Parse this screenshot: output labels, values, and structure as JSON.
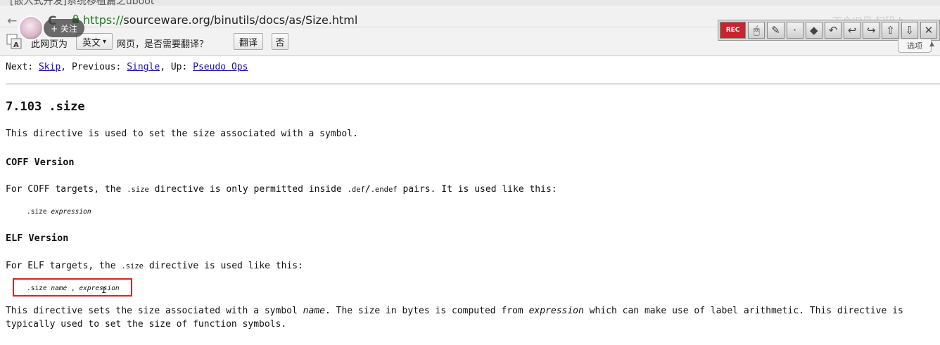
{
  "browser": {
    "tab_title": "[嵌入式开发]系统移植篇之uboot",
    "url_scheme": "https://",
    "url_rest": "sourceware.org/binutils/docs/as/Size.html",
    "back_glyph": "←",
    "forward_glyph": "→",
    "reload_glyph": "C",
    "ghost_text": "下个ID见 扫码 b"
  },
  "overlay": {
    "follow_label": "+ 关注"
  },
  "translate_bar": {
    "prefix": "此网页为",
    "language": "英文",
    "dropdown_glyph": "▾",
    "question": "网页，是否需要翻译？",
    "translate_button": "翻译",
    "no_button": "否",
    "options_label": "选项"
  },
  "toolbar": {
    "tools": [
      {
        "icon": "record-icon",
        "glyph": "REC"
      },
      {
        "icon": "mouse-icon",
        "glyph": "🖱"
      },
      {
        "icon": "pen-icon",
        "glyph": "✎"
      },
      {
        "icon": "dot-icon",
        "glyph": "·"
      },
      {
        "icon": "eraser-icon",
        "glyph": "◆"
      },
      {
        "icon": "undo-icon",
        "glyph": "↶"
      },
      {
        "icon": "arrow-left-icon",
        "glyph": "↩"
      },
      {
        "icon": "arrow-return-icon",
        "glyph": "↪"
      },
      {
        "icon": "up-icon",
        "glyph": "⇧"
      },
      {
        "icon": "down-icon",
        "glyph": "⇩"
      },
      {
        "icon": "close-icon",
        "glyph": "✕"
      }
    ]
  },
  "doc": {
    "nav": {
      "next_label": "Next:",
      "next_link": "Skip",
      "prev_label": "Previous:",
      "prev_link": "Single",
      "up_label": "Up:",
      "up_link": "Pseudo Ops"
    },
    "heading": "7.103 .size",
    "intro": "This directive is used to set the size associated with a symbol.",
    "coff_heading": "COFF Version",
    "coff_text_1": "For COFF targets, the",
    "coff_code_1": ".size",
    "coff_text_2": "directive is only permitted inside",
    "coff_code_2": ".def",
    "coff_slash": "/",
    "coff_code_3": ".endef",
    "coff_text_3": "pairs. It is used like this:",
    "coff_example_kw": ".size",
    "coff_example_arg": "expression",
    "elf_heading": "ELF Version",
    "elf_text_1": "For ELF targets, the",
    "elf_code": ".size",
    "elf_text_2": "directive is used like this:",
    "elf_example_kw": ".size",
    "elf_example_arg1": "name",
    "elf_example_sep": ",",
    "elf_example_arg2": "expression",
    "final_1": "This directive sets the size associated with a symbol",
    "final_name": "name",
    "final_2": ". The size in bytes is computed from",
    "final_expr": "expression",
    "final_3": "which can make use of label arithmetic. This directive is",
    "final_line2": "typically used to set the size of function symbols."
  }
}
